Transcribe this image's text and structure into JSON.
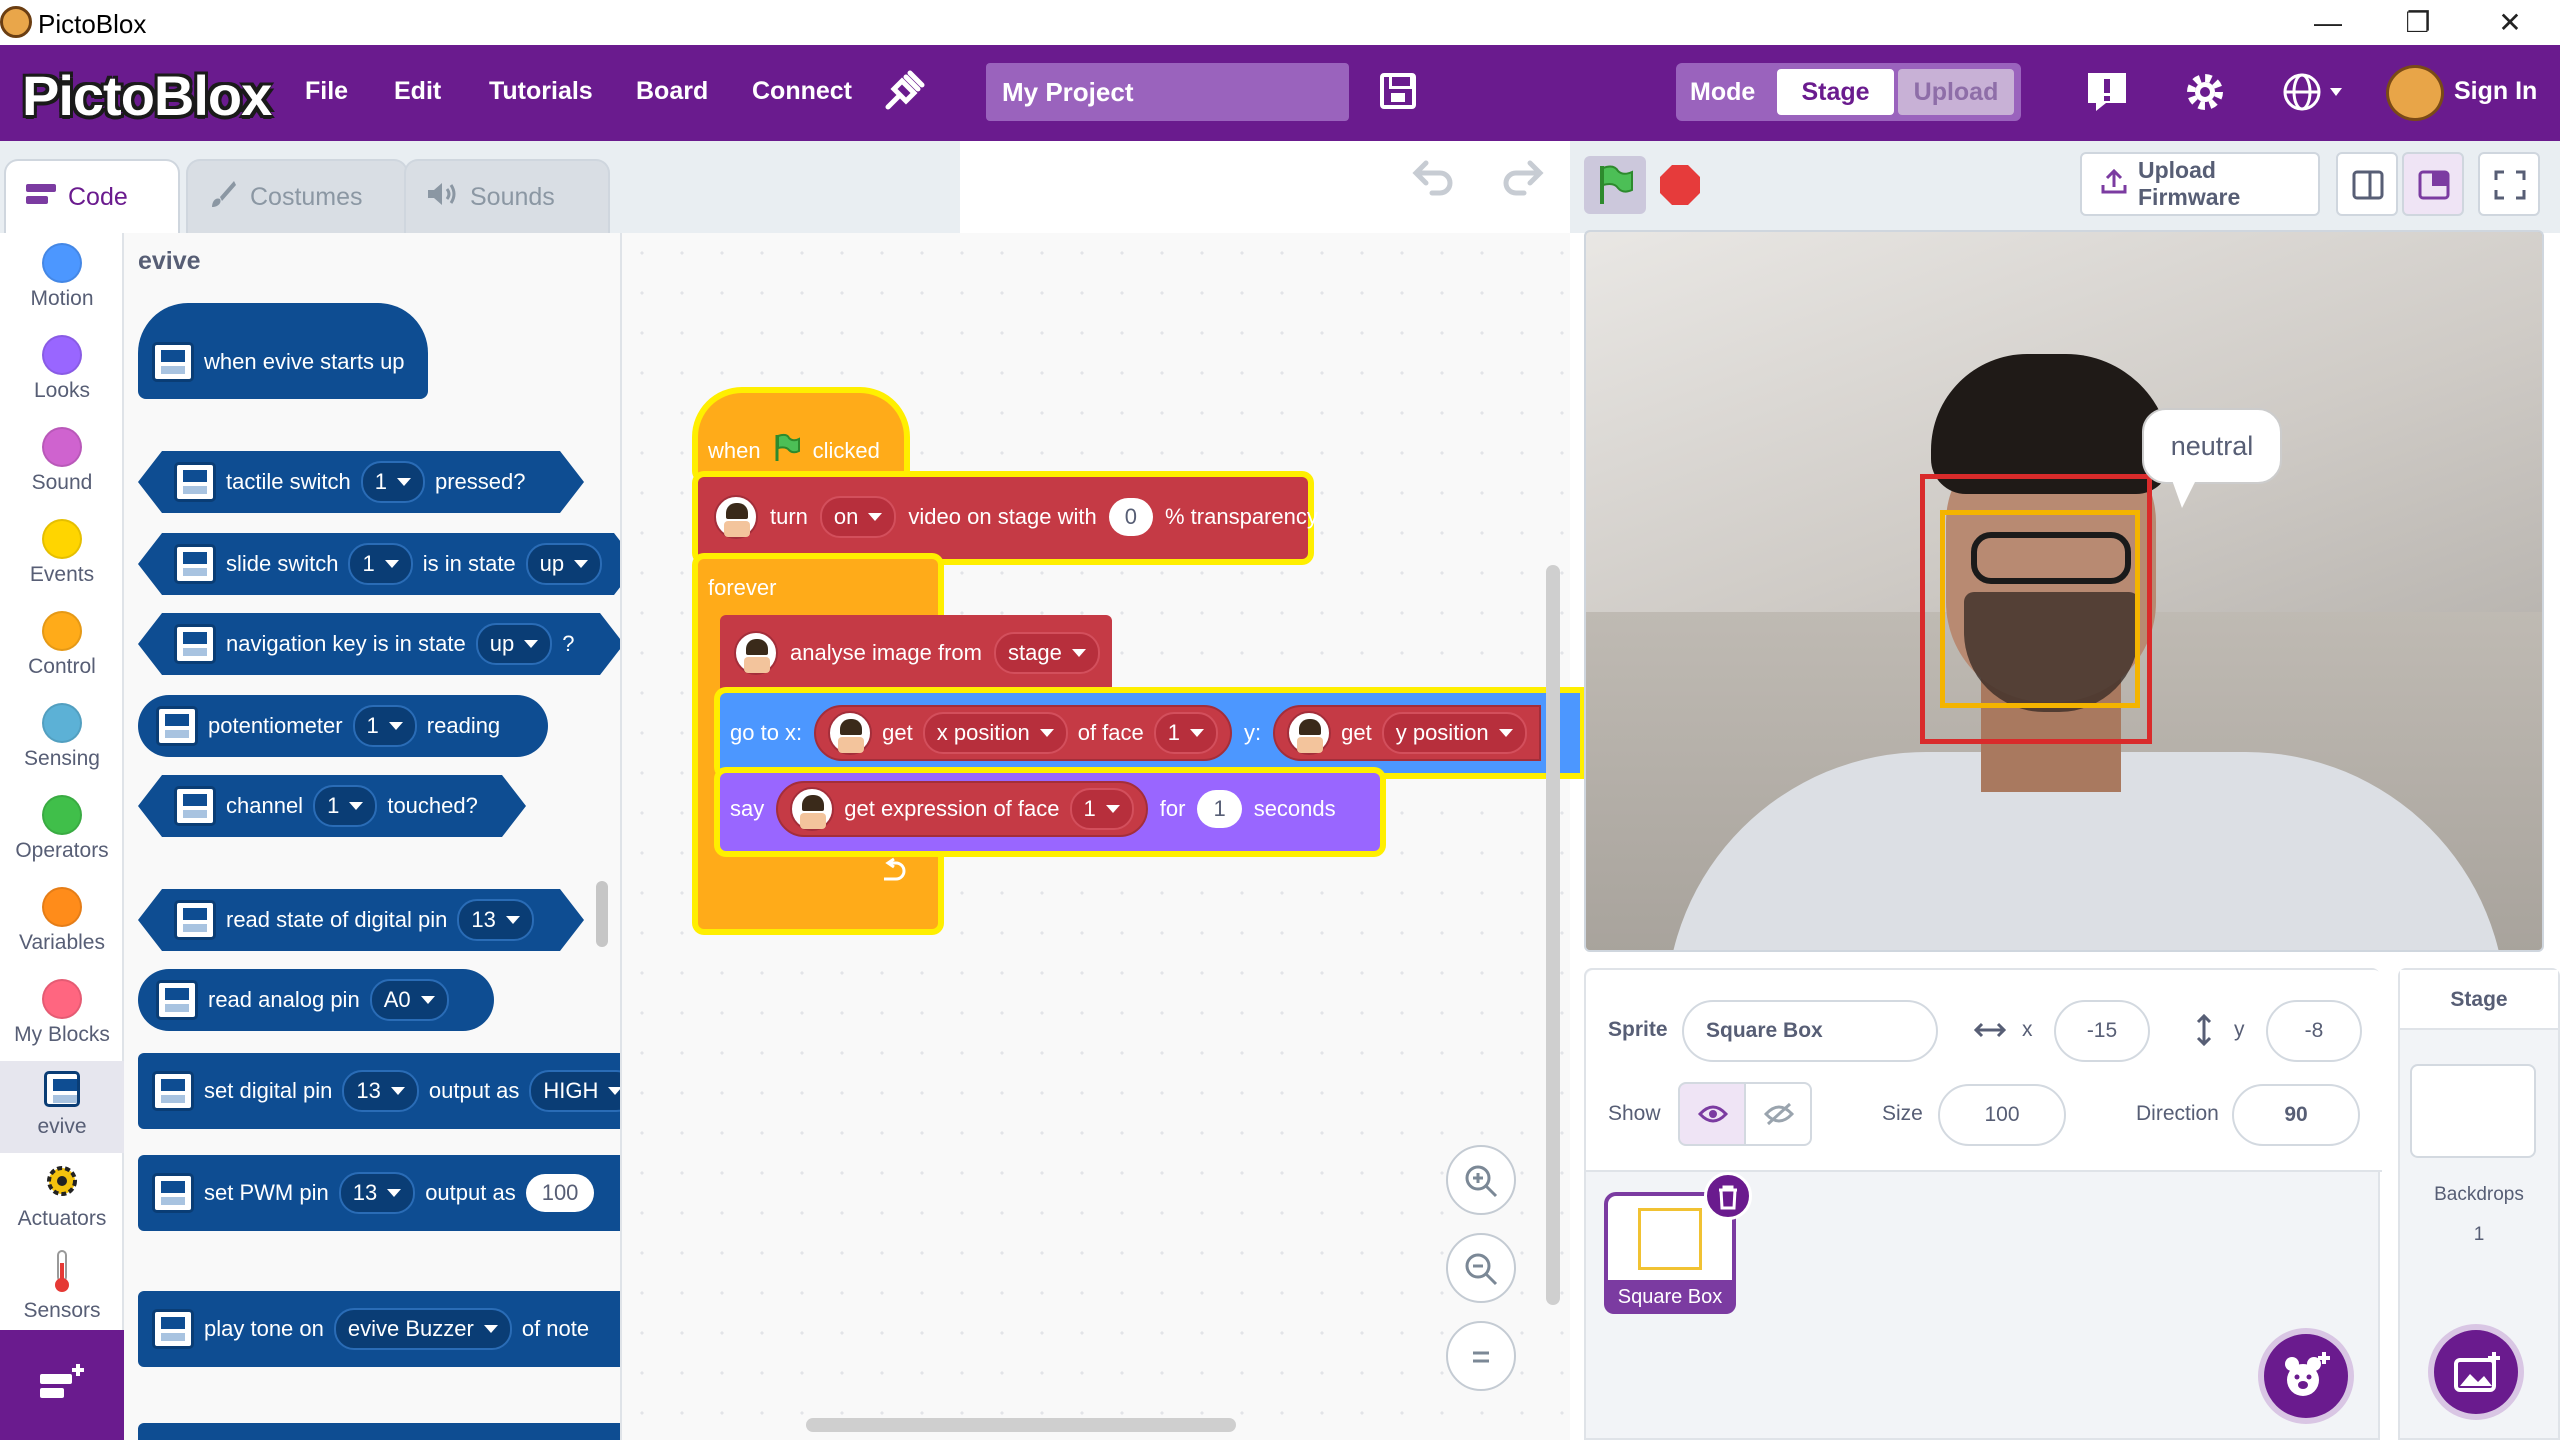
{
  "window": {
    "title": "PictoBlox",
    "minimize": "—",
    "maximize": "❐",
    "close": "✕"
  },
  "menubar": {
    "logo": "PictoBlox",
    "items": [
      "File",
      "Edit",
      "Tutorials",
      "Board",
      "Connect"
    ],
    "project_name": "My Project",
    "mode_label": "Mode",
    "mode_stage": "Stage",
    "mode_upload": "Upload",
    "sign_in": "Sign In"
  },
  "tabs": {
    "code": "Code",
    "costumes": "Costumes",
    "sounds": "Sounds"
  },
  "categories": [
    {
      "label": "Motion",
      "color": "#4c97ff"
    },
    {
      "label": "Looks",
      "color": "#9966ff"
    },
    {
      "label": "Sound",
      "color": "#cf63cf"
    },
    {
      "label": "Events",
      "color": "#ffd500"
    },
    {
      "label": "Control",
      "color": "#ffab19"
    },
    {
      "label": "Sensing",
      "color": "#5cb1d6"
    },
    {
      "label": "Operators",
      "color": "#40bf4a"
    },
    {
      "label": "Variables",
      "color": "#ff8c1a"
    },
    {
      "label": "My Blocks",
      "color": "#ff6680"
    },
    {
      "label": "evive",
      "color": "#0e4d92",
      "selected": true
    },
    {
      "label": "Actuators",
      "color": "#f4c20d"
    },
    {
      "label": "Sensors",
      "color": "#e53935"
    }
  ],
  "palette": {
    "title": "evive",
    "blocks": {
      "hat": "when evive starts up",
      "tactile": {
        "a": "tactile switch",
        "dd": "1",
        "b": "pressed?"
      },
      "slide": {
        "a": "slide switch",
        "dd": "1",
        "b": "is in state",
        "dd2": "up"
      },
      "nav": {
        "a": "navigation key is in state",
        "dd": "up",
        "b": "?"
      },
      "pot": {
        "a": "potentiometer",
        "dd": "1",
        "b": "reading"
      },
      "channel": {
        "a": "channel",
        "dd": "1",
        "b": "touched?"
      },
      "digital": {
        "a": "read state of digital pin",
        "dd": "13"
      },
      "analog": {
        "a": "read analog pin",
        "dd": "A0"
      },
      "setdig": {
        "a": "set digital pin",
        "dd": "13",
        "b": "output as",
        "dd2": "HIGH"
      },
      "pwm": {
        "a": "set PWM pin",
        "dd": "13",
        "b": "output as",
        "val": "100"
      },
      "tone": {
        "a": "play tone on",
        "dd": "evive Buzzer",
        "b": "of note"
      }
    }
  },
  "script": {
    "when": "when",
    "clicked": "clicked",
    "turn": "turn",
    "turn_dd": "on",
    "video": "video on stage with",
    "transp_val": "0",
    "transp": "% transparency",
    "forever": "forever",
    "analyse": "analyse image from",
    "analyse_dd": "stage",
    "goto": "go to x:",
    "get1": "get",
    "xpos_dd": "x position",
    "of_face": "of face",
    "face_dd": "1",
    "y": "y:",
    "get2": "get",
    "ypos_dd": "y position",
    "say": "say",
    "get_expr": "get expression of face",
    "expr_dd": "1",
    "for": "for",
    "secs_val": "1",
    "seconds": "seconds"
  },
  "stage_header": {
    "upload_firmware": "Upload Firmware"
  },
  "stage": {
    "speech": "neutral"
  },
  "sprite_info": {
    "sprite_label": "Sprite",
    "sprite_name": "Square Box",
    "x_label": "x",
    "x": "-15",
    "y_label": "y",
    "y": "-8",
    "show_label": "Show",
    "size_label": "Size",
    "size": "100",
    "direction_label": "Direction",
    "direction": "90"
  },
  "sprites": [
    {
      "name": "Square Box"
    }
  ],
  "stage_pane": {
    "title": "Stage",
    "backdrops_label": "Backdrops",
    "backdrops_count": "1"
  }
}
